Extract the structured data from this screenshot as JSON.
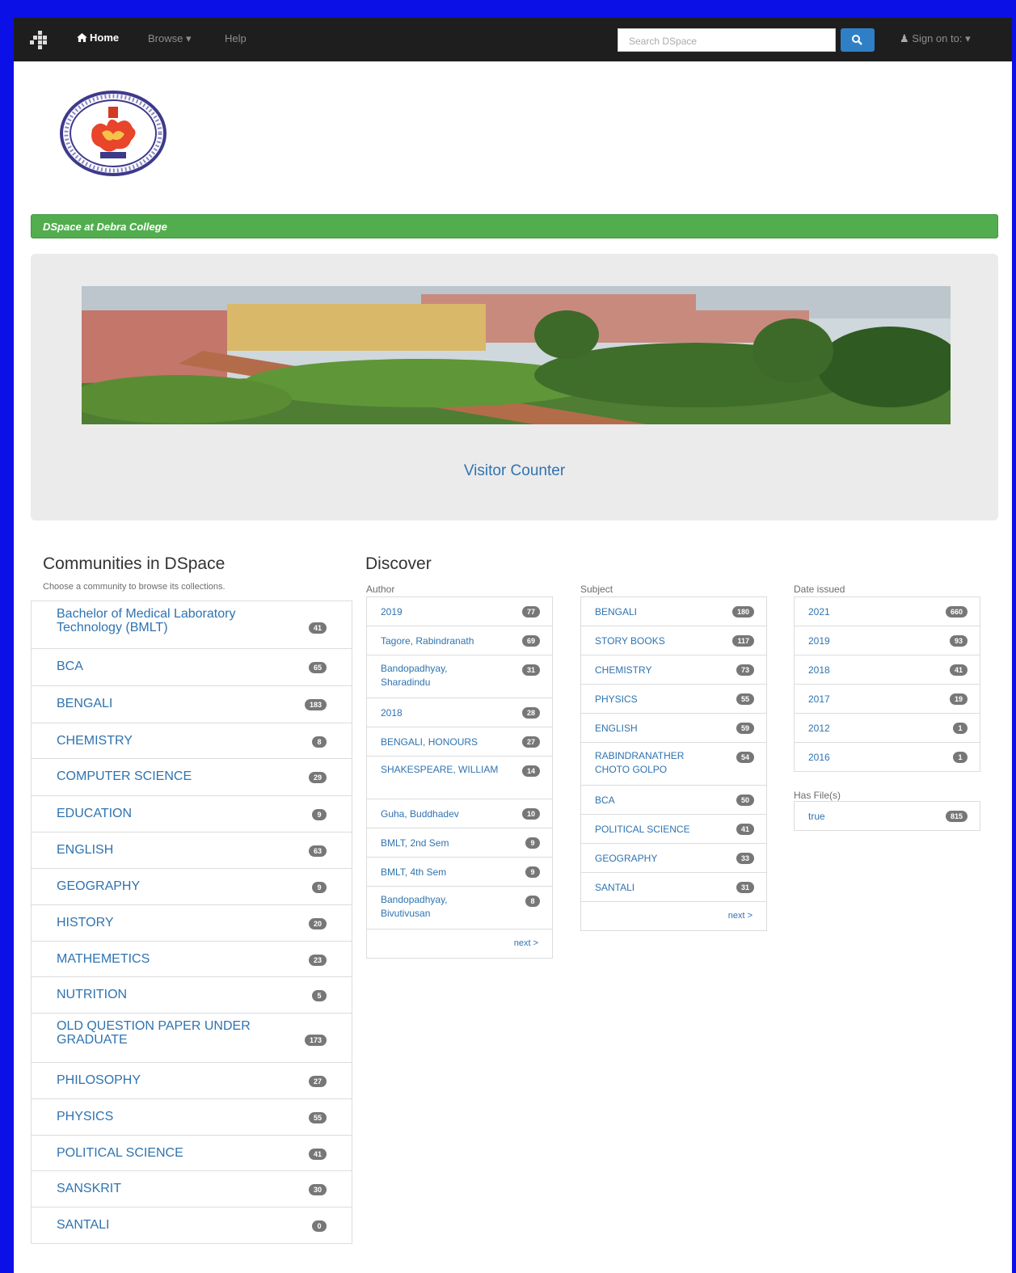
{
  "navbar": {
    "home_label": "Home",
    "browse_label": "Browse",
    "help_label": "Help",
    "search_placeholder": "Search DSpace",
    "sign_in_label": "Sign on to:"
  },
  "breadcrumb": {
    "label": "DSpace at Debra College"
  },
  "jumbotron": {
    "counter_label": "Visitor Counter"
  },
  "communities": {
    "title": "Communities in DSpace",
    "subtitle": "Choose a community to browse its collections.",
    "items": [
      {
        "label": "Bachelor of Medical Laboratory Technology (BMLT)",
        "count": "41"
      },
      {
        "label": "BCA",
        "count": "65"
      },
      {
        "label": "BENGALI",
        "count": "183"
      },
      {
        "label": "CHEMISTRY",
        "count": "8"
      },
      {
        "label": "COMPUTER SCIENCE",
        "count": "29"
      },
      {
        "label": "EDUCATION",
        "count": "9"
      },
      {
        "label": "ENGLISH",
        "count": "63"
      },
      {
        "label": "GEOGRAPHY",
        "count": "9"
      },
      {
        "label": "HISTORY",
        "count": "20"
      },
      {
        "label": "MATHEMETICS",
        "count": "23"
      },
      {
        "label": "NUTRITION",
        "count": "5"
      },
      {
        "label": "OLD QUESTION PAPER UNDER GRADUATE",
        "count": "173"
      },
      {
        "label": "PHILOSOPHY",
        "count": "27"
      },
      {
        "label": "PHYSICS",
        "count": "55"
      },
      {
        "label": "POLITICAL SCIENCE",
        "count": "41"
      },
      {
        "label": "SANSKRIT",
        "count": "30"
      },
      {
        "label": "SANTALI",
        "count": "0"
      }
    ]
  },
  "discover": {
    "title": "Discover",
    "author": {
      "heading": "Author",
      "next_label": "next >",
      "items": [
        {
          "label": "2019",
          "count": "77"
        },
        {
          "label": "Tagore, Rabindranath",
          "count": "69"
        },
        {
          "label": "Bandopadhyay, Sharadindu",
          "count": "31"
        },
        {
          "label": "2018",
          "count": "28"
        },
        {
          "label": "BENGALI, HONOURS",
          "count": "27"
        },
        {
          "label": "SHAKESPEARE, WILLIAM",
          "count": "14"
        },
        {
          "label": "Guha, Buddhadev",
          "count": "10"
        },
        {
          "label": "BMLT, 2nd Sem",
          "count": "9"
        },
        {
          "label": "BMLT, 4th Sem",
          "count": "9"
        },
        {
          "label": "Bandopadhyay, Bivutivusan",
          "count": "8"
        }
      ]
    },
    "subject": {
      "heading": "Subject",
      "next_label": "next >",
      "items": [
        {
          "label": "BENGALI",
          "count": "180"
        },
        {
          "label": "STORY BOOKS",
          "count": "117"
        },
        {
          "label": "CHEMISTRY",
          "count": "73"
        },
        {
          "label": "PHYSICS",
          "count": "55"
        },
        {
          "label": "ENGLISH",
          "count": "59"
        },
        {
          "label": "RABINDRANATHER CHOTO GOLPO",
          "count": "54"
        },
        {
          "label": "BCA",
          "count": "50"
        },
        {
          "label": "POLITICAL SCIENCE",
          "count": "41"
        },
        {
          "label": "GEOGRAPHY",
          "count": "33"
        },
        {
          "label": "SANTALI",
          "count": "31"
        }
      ]
    },
    "date": {
      "heading": "Date issued",
      "items": [
        {
          "label": "2021",
          "count": "660"
        },
        {
          "label": "2019",
          "count": "93"
        },
        {
          "label": "2018",
          "count": "41"
        },
        {
          "label": "2017",
          "count": "19"
        },
        {
          "label": "2012",
          "count": "1"
        },
        {
          "label": "2016",
          "count": "1"
        }
      ]
    },
    "has_files": {
      "heading": "Has File(s)",
      "items": [
        {
          "label": "true",
          "count": "815"
        }
      ]
    }
  }
}
